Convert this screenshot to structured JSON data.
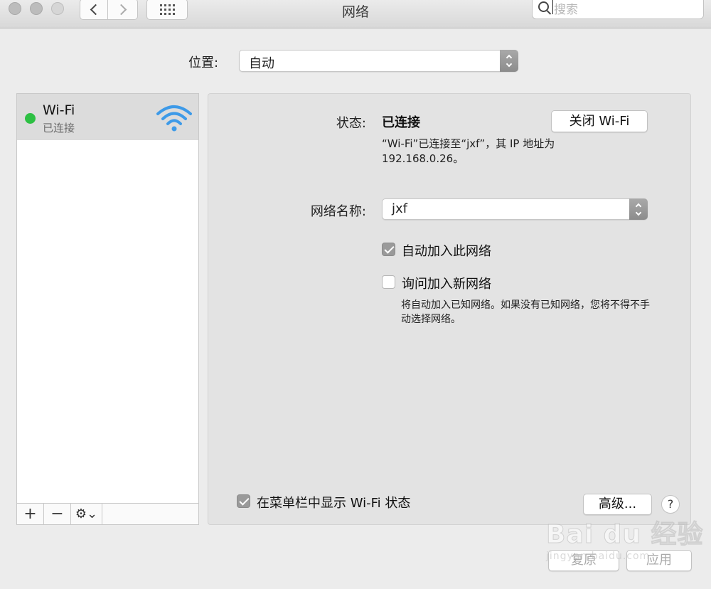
{
  "window": {
    "title": "网络"
  },
  "toolbar": {
    "back_icon": "chevron-left-icon",
    "forward_icon": "chevron-right-icon",
    "grid_icon": "grid-icon"
  },
  "search": {
    "placeholder": "搜索"
  },
  "location": {
    "label": "位置:",
    "value": "自动"
  },
  "sidebar": {
    "services": [
      {
        "name": "Wi-Fi",
        "status": "已连接",
        "status_color": "#2dc043",
        "icon": "wifi-icon"
      }
    ],
    "tools": {
      "add": "+",
      "remove": "−",
      "gear": "⚙⌄"
    }
  },
  "detail": {
    "status_label": "状态:",
    "status_value": "已连接",
    "turn_off_button": "关闭 Wi-Fi",
    "status_description": "“Wi-Fi”已连接至“jxf”，其 IP 地址为 192.168.0.26。",
    "network_name_label": "网络名称:",
    "network_name_value": "jxf",
    "auto_join": {
      "label": "自动加入此网络",
      "checked": true
    },
    "ask_join": {
      "label": "询问加入新网络",
      "checked": false
    },
    "ask_join_description": "将自动加入已知网络。如果没有已知网络，您将不得不手动选择网络。",
    "show_in_menubar": {
      "label": "在菜单栏中显示 Wi-Fi 状态",
      "checked": true
    },
    "advanced_button": "高级...",
    "help_button": "?"
  },
  "footer": {
    "revert_button": "复原",
    "apply_button": "应用"
  },
  "watermark": {
    "brand": "Bai du 经验",
    "url": "jingyan.baidu.com"
  }
}
